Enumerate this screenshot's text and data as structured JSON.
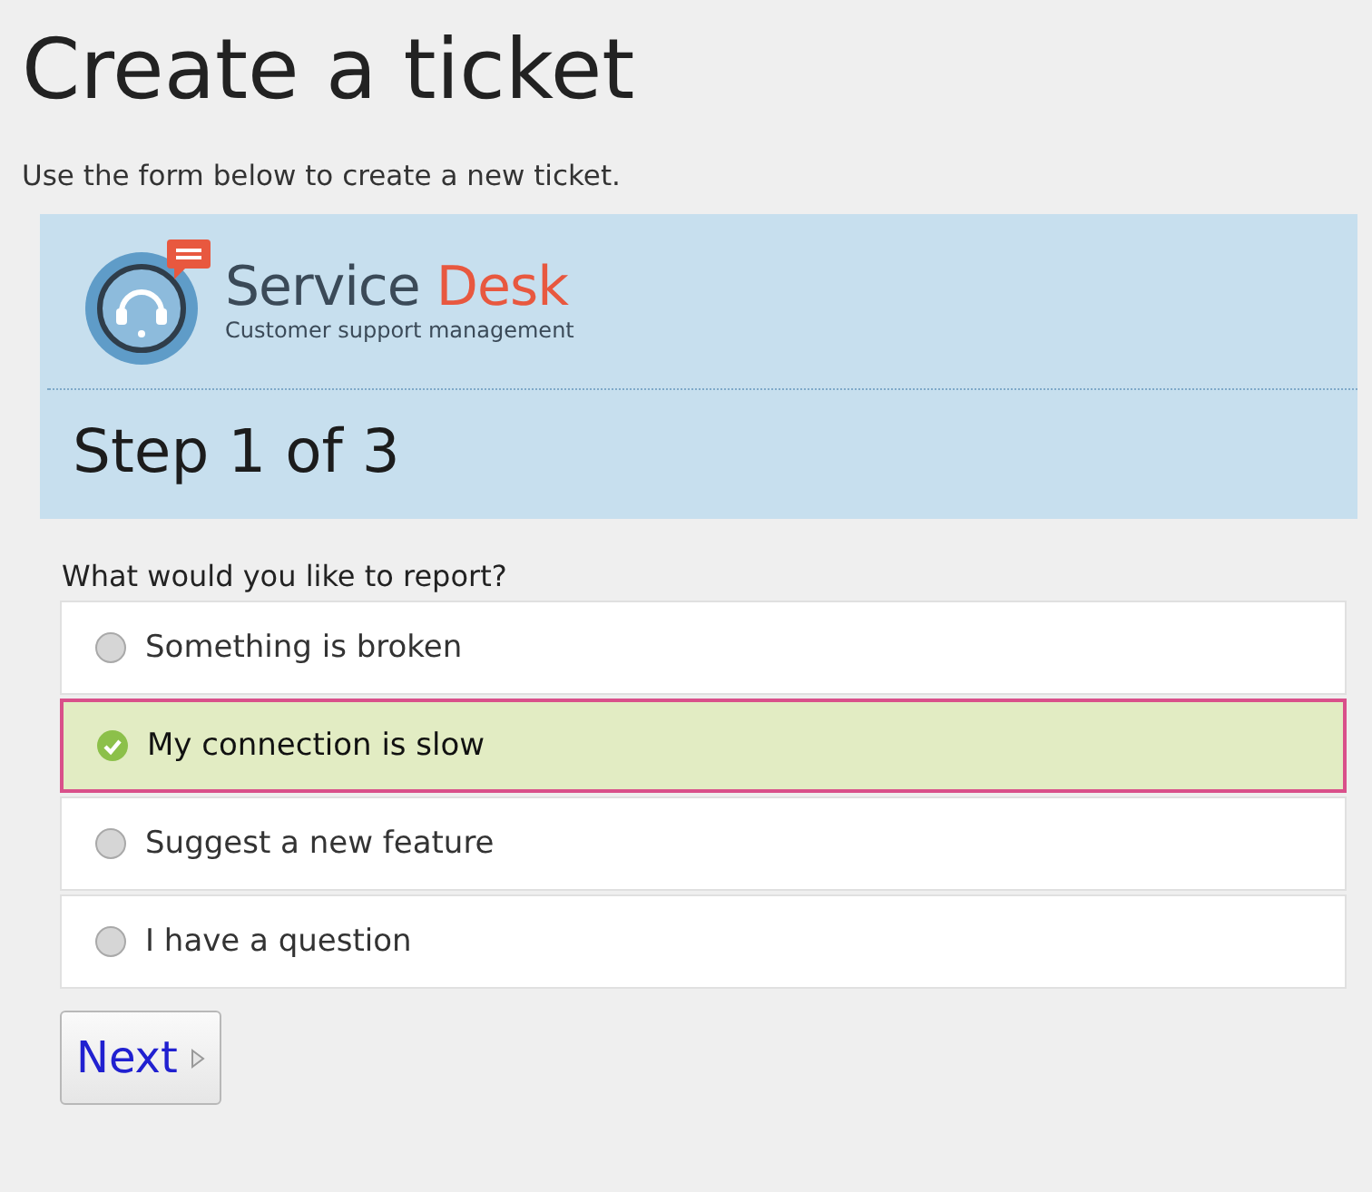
{
  "title": "Create a ticket",
  "intro": "Use the form below to create a new ticket.",
  "logo": {
    "name": "Service",
    "accent": "Desk",
    "tagline": "Customer support management"
  },
  "step": "Step 1 of 3",
  "question": "What would you like to report?",
  "options": [
    {
      "label": "Something is broken",
      "selected": false
    },
    {
      "label": "My connection is slow",
      "selected": true
    },
    {
      "label": "Suggest a new feature",
      "selected": false
    },
    {
      "label": "I have a question",
      "selected": false
    }
  ],
  "next_button": "Next"
}
